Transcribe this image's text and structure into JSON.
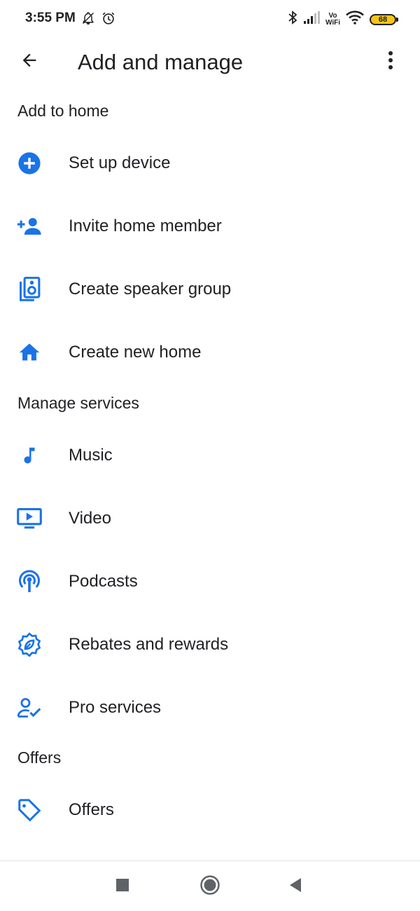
{
  "status_bar": {
    "time": "3:55 PM",
    "vowifi_top": "Vo",
    "vowifi_bottom": "WiFi",
    "battery_level": "68",
    "battery_color": "#f5c518"
  },
  "app_bar": {
    "title": "Add and manage",
    "back_icon": "arrow-back-icon",
    "more_icon": "more-vert-icon"
  },
  "accent_color": "#1a73e8",
  "sections": {
    "add_to_home": {
      "header": "Add to home",
      "items": [
        {
          "label": "Set up device",
          "icon": "add-circle-icon"
        },
        {
          "label": "Invite home member",
          "icon": "person-add-icon"
        },
        {
          "label": "Create speaker group",
          "icon": "speaker-group-icon"
        },
        {
          "label": "Create new home",
          "icon": "home-icon"
        }
      ]
    },
    "manage_services": {
      "header": "Manage services",
      "items": [
        {
          "label": "Music",
          "icon": "music-note-icon"
        },
        {
          "label": "Video",
          "icon": "video-icon"
        },
        {
          "label": "Podcasts",
          "icon": "podcast-icon"
        },
        {
          "label": "Rebates and rewards",
          "icon": "rewards-icon"
        },
        {
          "label": "Pro services",
          "icon": "pro-services-icon"
        }
      ]
    },
    "offers": {
      "header": "Offers",
      "items": [
        {
          "label": "Offers",
          "icon": "tag-icon"
        }
      ]
    }
  },
  "nav_bar": {
    "recents_icon": "square-icon",
    "home_icon": "circle-icon",
    "back_icon": "triangle-back-icon"
  }
}
